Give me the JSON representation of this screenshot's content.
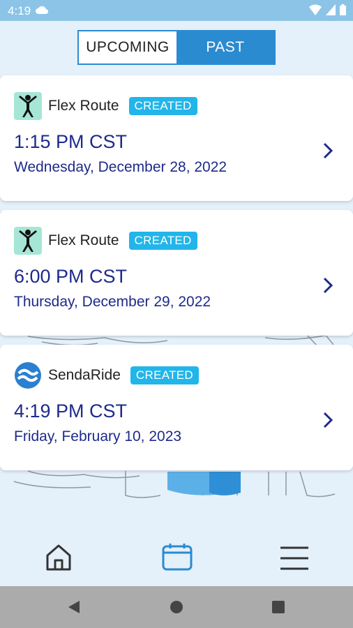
{
  "status_bar": {
    "time": "4:19"
  },
  "tabs": [
    {
      "label": "UPCOMING",
      "active": false
    },
    {
      "label": "PAST",
      "active": true
    }
  ],
  "trips": [
    {
      "provider": "Flex Route",
      "logo": "flex-route-person-icon",
      "status": "CREATED",
      "time": "1:15 PM CST",
      "date": "Wednesday, December 28, 2022"
    },
    {
      "provider": "Flex Route",
      "logo": "flex-route-person-icon",
      "status": "CREATED",
      "time": "6:00 PM CST",
      "date": "Thursday, December 29, 2022"
    },
    {
      "provider": "SendaRide",
      "logo": "sendaride-logo",
      "status": "CREATED",
      "time": "4:19 PM CST",
      "date": "Friday, February 10, 2023"
    }
  ],
  "bottom_nav": [
    {
      "icon": "home-icon",
      "active": false
    },
    {
      "icon": "calendar-icon",
      "active": true
    },
    {
      "icon": "menu-icon",
      "active": false
    }
  ],
  "colors": {
    "accent": "#2a8bd0",
    "badge": "#22b5e9",
    "text_primary": "#1e2a8a",
    "background": "#e4f0fa"
  }
}
